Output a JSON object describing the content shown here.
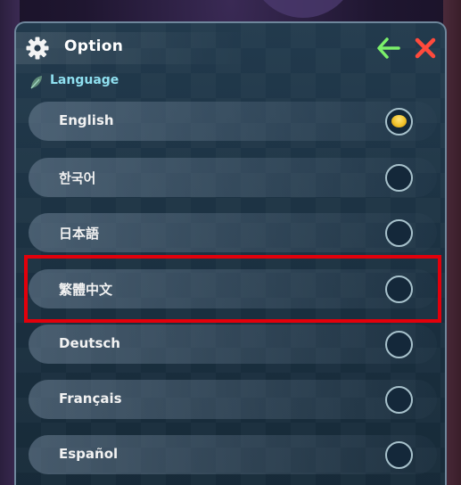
{
  "header": {
    "title": "Option",
    "icons": {
      "settings": "gear-icon",
      "back": "back-arrow-icon",
      "close": "close-icon"
    },
    "colors": {
      "back_arrow": "#7bf06a",
      "close": "#ff4a3c"
    }
  },
  "section": {
    "label": "Language",
    "icon": "leaf-icon"
  },
  "languages": [
    {
      "label": "English",
      "selected": true
    },
    {
      "label": "한국어",
      "selected": false
    },
    {
      "label": "日本語",
      "selected": false
    },
    {
      "label": "繁體中文",
      "selected": false
    },
    {
      "label": "Deutsch",
      "selected": false
    },
    {
      "label": "Français",
      "selected": false
    },
    {
      "label": "Español",
      "selected": false
    }
  ],
  "annotation": {
    "highlighted_option": "繁體中文",
    "color": "#e3000b"
  }
}
